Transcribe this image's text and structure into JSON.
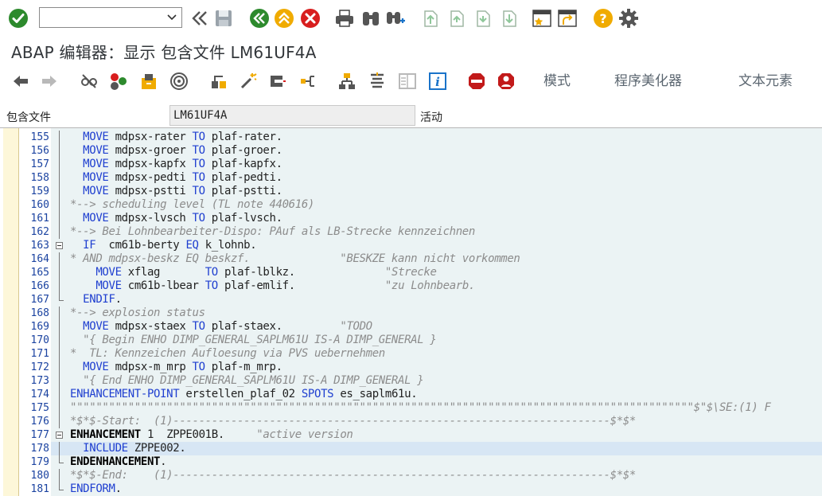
{
  "toolbar": {
    "command_field": {
      "value": "",
      "placeholder": ""
    },
    "icons": [
      "enter-check-icon",
      "command-dropdown-icon",
      "collapse-icon",
      "save-icon",
      "back-icon",
      "exit-icon",
      "cancel-icon",
      "print-icon",
      "find-icon",
      "find-next-icon",
      "first-page-icon",
      "previous-page-icon",
      "next-page-icon",
      "last-page-icon",
      "new-session-icon",
      "shortcut-icon",
      "help-icon",
      "settings-icon"
    ]
  },
  "title": "ABAP 编辑器：显示 包含文件 LM61UF4A",
  "app_toolbar": {
    "buttons": {
      "mode": "模式",
      "pretty_printer": "程序美化器",
      "text_elements": "文本元素"
    }
  },
  "include": {
    "label": "包含文件",
    "value": "LM61UF4A",
    "status": "活动"
  },
  "colors": {
    "keyword": "#1f3fd0",
    "comment": "#8c8c8c",
    "line_number": "#1b43a0",
    "editor_bg": "#ebf3f4"
  },
  "editor": {
    "lines": [
      {
        "n": "155",
        "fold": "bar",
        "tokens": [
          [
            "p",
            "  "
          ],
          [
            "k",
            "MOVE"
          ],
          [
            "p",
            " mdpsx-rater "
          ],
          [
            "k",
            "TO"
          ],
          [
            "p",
            " plaf-rater."
          ]
        ]
      },
      {
        "n": "156",
        "fold": "bar",
        "tokens": [
          [
            "p",
            "  "
          ],
          [
            "k",
            "MOVE"
          ],
          [
            "p",
            " mdpsx-groer "
          ],
          [
            "k",
            "TO"
          ],
          [
            "p",
            " plaf-groer."
          ]
        ]
      },
      {
        "n": "157",
        "fold": "bar",
        "tokens": [
          [
            "p",
            "  "
          ],
          [
            "k",
            "MOVE"
          ],
          [
            "p",
            " mdpsx-kapfx "
          ],
          [
            "k",
            "TO"
          ],
          [
            "p",
            " plaf-kapfx."
          ]
        ]
      },
      {
        "n": "158",
        "fold": "bar",
        "tokens": [
          [
            "p",
            "  "
          ],
          [
            "k",
            "MOVE"
          ],
          [
            "p",
            " mdpsx-pedti "
          ],
          [
            "k",
            "TO"
          ],
          [
            "p",
            " plaf-pedti."
          ]
        ]
      },
      {
        "n": "159",
        "fold": "bar",
        "tokens": [
          [
            "p",
            "  "
          ],
          [
            "k",
            "MOVE"
          ],
          [
            "p",
            " mdpsx-pstti "
          ],
          [
            "k",
            "TO"
          ],
          [
            "p",
            " plaf-pstti."
          ]
        ]
      },
      {
        "n": "160",
        "fold": "bar",
        "tokens": [
          [
            "c",
            "*--> scheduling level (TL note 440616)"
          ]
        ]
      },
      {
        "n": "161",
        "fold": "bar",
        "tokens": [
          [
            "p",
            "  "
          ],
          [
            "k",
            "MOVE"
          ],
          [
            "p",
            " mdpsx-lvsch "
          ],
          [
            "k",
            "TO"
          ],
          [
            "p",
            " plaf-lvsch."
          ]
        ]
      },
      {
        "n": "162",
        "fold": "bar",
        "tokens": [
          [
            "c",
            "*--> Bei Lohnbearbeiter-Dispo: PAuf als LB-Strecke kennzeichnen"
          ]
        ]
      },
      {
        "n": "163",
        "fold": "box",
        "tokens": [
          [
            "p",
            "  "
          ],
          [
            "k",
            "IF"
          ],
          [
            "p",
            "  cm61b-berty "
          ],
          [
            "k",
            "EQ"
          ],
          [
            "p",
            " k_lohnb."
          ]
        ]
      },
      {
        "n": "164",
        "fold": "bar",
        "tokens": [
          [
            "c",
            "* AND mdpsx-beskz EQ beskzf.              \"BESKZE kann nicht vorkommen"
          ]
        ]
      },
      {
        "n": "165",
        "fold": "bar",
        "tokens": [
          [
            "p",
            "    "
          ],
          [
            "k",
            "MOVE"
          ],
          [
            "p",
            " xflag       "
          ],
          [
            "k",
            "TO"
          ],
          [
            "p",
            " plaf-lblkz.              "
          ],
          [
            "c",
            "\"Strecke"
          ]
        ]
      },
      {
        "n": "166",
        "fold": "bar",
        "tokens": [
          [
            "p",
            "    "
          ],
          [
            "k",
            "MOVE"
          ],
          [
            "p",
            " cm61b-lbear "
          ],
          [
            "k",
            "TO"
          ],
          [
            "p",
            " plaf-emlif.              "
          ],
          [
            "c",
            "\"zu Lohnbearb."
          ]
        ]
      },
      {
        "n": "167",
        "fold": "end",
        "tokens": [
          [
            "p",
            "  "
          ],
          [
            "k",
            "ENDIF"
          ],
          [
            "p",
            "."
          ]
        ]
      },
      {
        "n": "168",
        "fold": "bar",
        "tokens": [
          [
            "c",
            "*--> explosion status"
          ]
        ]
      },
      {
        "n": "169",
        "fold": "bar",
        "tokens": [
          [
            "p",
            "  "
          ],
          [
            "k",
            "MOVE"
          ],
          [
            "p",
            " mdpsx-staex "
          ],
          [
            "k",
            "TO"
          ],
          [
            "p",
            " plaf-staex.         "
          ],
          [
            "c",
            "\"TODO"
          ]
        ]
      },
      {
        "n": "170",
        "fold": "bar",
        "tokens": [
          [
            "c",
            "  \"{ Begin ENHO DIMP_GENERAL_SAPLM61U IS-A DIMP_GENERAL }"
          ]
        ]
      },
      {
        "n": "171",
        "fold": "bar",
        "tokens": [
          [
            "c",
            "*  TL: Kennzeichen Aufloesung via PVS uebernehmen"
          ]
        ]
      },
      {
        "n": "172",
        "fold": "bar",
        "tokens": [
          [
            "p",
            "  "
          ],
          [
            "k",
            "MOVE"
          ],
          [
            "p",
            " mdpsx-m_mrp "
          ],
          [
            "k",
            "TO"
          ],
          [
            "p",
            " plaf-m_mrp."
          ]
        ]
      },
      {
        "n": "173",
        "fold": "bar",
        "tokens": [
          [
            "c",
            "  \"{ End ENHO DIMP_GENERAL_SAPLM61U IS-A DIMP_GENERAL }"
          ]
        ]
      },
      {
        "n": "174",
        "fold": "bar",
        "tokens": [
          [
            "k",
            "ENHANCEMENT-POINT"
          ],
          [
            "p",
            " erstellen_plaf_02 "
          ],
          [
            "k",
            "SPOTS"
          ],
          [
            "p",
            " es_saplm61u."
          ]
        ]
      },
      {
        "n": "175",
        "fold": "bar",
        "tokens": [
          [
            "c",
            "\"\"\"\"\"\"\"\"\"\"\"\"\"\"\"\"\"\"\"\"\"\"\"\"\"\"\"\"\"\"\"\"\"\"\"\"\"\"\"\"\"\"\"\"\"\"\"\"\"\"\"\"\"\"\"\"\"\"\"\"\"\"\"\"\"\"\"\"\"\"\"\"\"\"\"\"\"\"\"\"\"\"\"\"\"\"\"\"\"\"\"\"\"\"\"\"\"$\"$\\SE:(1) F"
          ]
        ]
      },
      {
        "n": "176",
        "fold": "bar",
        "tokens": [
          [
            "c",
            "*$*$-Start:  (1)--------------------------------------------------------------------$*$*"
          ]
        ]
      },
      {
        "n": "177",
        "fold": "box",
        "tokens": [
          [
            "b",
            "ENHANCEMENT"
          ],
          [
            "p",
            " 1  ZPPE001B.     "
          ],
          [
            "c",
            "\"active version"
          ]
        ]
      },
      {
        "n": "178",
        "fold": "bar",
        "hl": true,
        "tokens": [
          [
            "p",
            "  "
          ],
          [
            "k",
            "INCLUDE"
          ],
          [
            "p",
            " ZPPE002."
          ]
        ]
      },
      {
        "n": "179",
        "fold": "end",
        "tokens": [
          [
            "b",
            "ENDENHANCEMENT"
          ],
          [
            "p",
            "."
          ]
        ]
      },
      {
        "n": "180",
        "fold": "bar",
        "tokens": [
          [
            "c",
            "*$*$-End:    (1)--------------------------------------------------------------------$*$*"
          ]
        ]
      },
      {
        "n": "181",
        "fold": "end",
        "tokens": [
          [
            "k",
            "ENDFORM"
          ],
          [
            "p",
            "."
          ]
        ]
      }
    ]
  }
}
